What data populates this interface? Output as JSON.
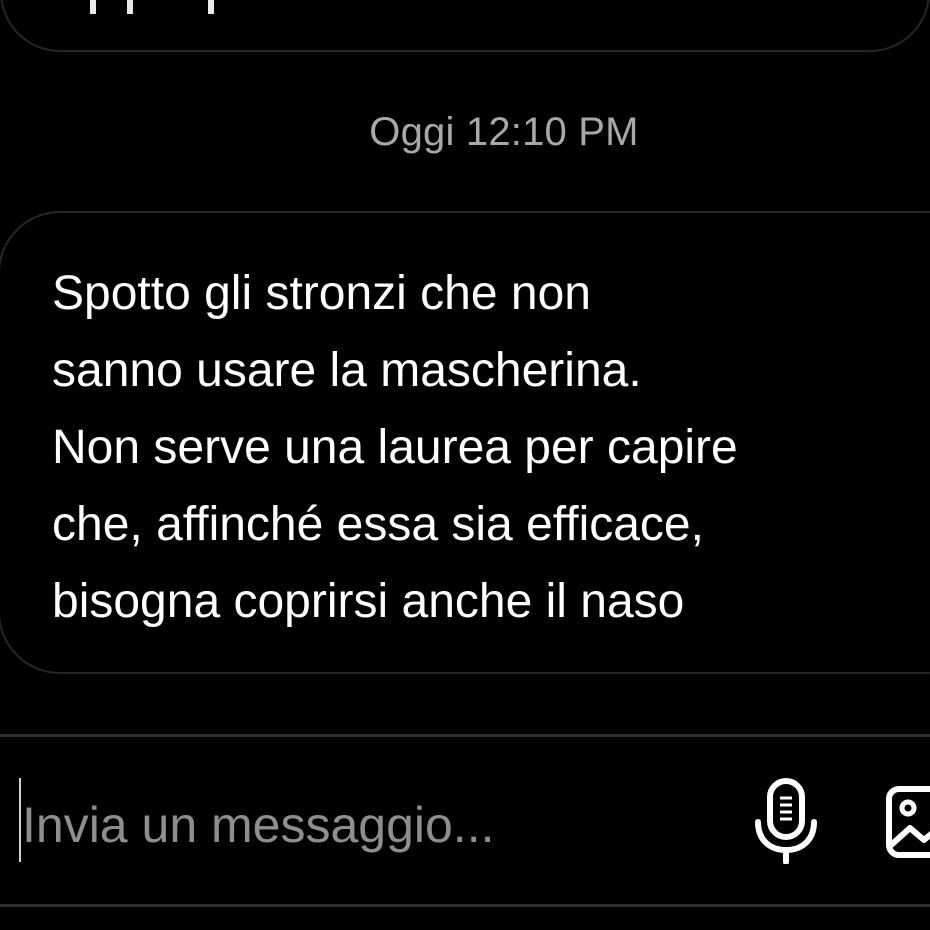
{
  "previous_message": {
    "visible": true
  },
  "thread": {
    "timestamp": "Oggi 12:10 PM",
    "message": "Spotto gli stronzi che non\nsanno usare la mascherina.\nNon serve una laurea per capire\nche, affinché essa sia efficace,\nbisogna coprirsi anche il naso"
  },
  "composer": {
    "placeholder": "Invia un messaggio...",
    "value": "",
    "icons": [
      "microphone-icon",
      "gallery-icon"
    ]
  },
  "colors": {
    "background": "#000000",
    "bubble_border": "#262626",
    "text": "#ffffff",
    "timestamp": "#a8a8a8",
    "placeholder": "#8e8e8e"
  }
}
